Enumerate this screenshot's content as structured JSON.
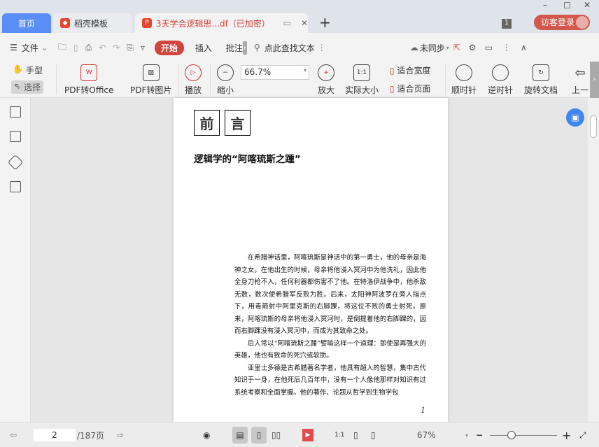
{
  "tabs": [
    {
      "label": "首页"
    },
    {
      "label": "稻壳模板"
    },
    {
      "label": "3天学会逻辑思...df（已加密）"
    }
  ],
  "window": {
    "page_badge": "1",
    "login": "访客登录"
  },
  "toolbar": {
    "file": "文件",
    "start": "开始",
    "insert": "插入",
    "annotate": "批注",
    "search": "点此查找文本",
    "sync": "未同步"
  },
  "ribbon": {
    "hand": "手型",
    "select": "选择",
    "pdf_office": "PDF转Office",
    "pdf_image": "PDF转图片",
    "play": "播放",
    "zoom_out": "缩小",
    "zoom_value": "66.7%",
    "zoom_in": "放大",
    "actual": "实际大小",
    "fit_width": "适合宽度",
    "fit_page": "适合页面",
    "cw": "顺时针",
    "ccw": "逆时针",
    "rotate": "旋转文档",
    "prev": "上一"
  },
  "document": {
    "head1": "前",
    "head2": "言",
    "subtitle": "逻辑学的“阿喀琉斯之踵”",
    "paragraphs": [
      "在希腊神话里，阿喀琉斯是神话中的第一勇士，他的母亲是海神之女，在他出生的时候，母亲将他浸入冥河中为他洗礼，因此他全身刀枪不入，任何利器都伤害不了他。在特洛伊战争中，他杀敌无数，数次使希腊军反败为胜。后来，太阳神阿波罗在旁人指点下，用毒箭射中阿里克斯的右脚踝，将这位不败的勇士射死。原来，阿喀琉斯的母亲将他浸入冥河时，是倒提着他的右脚踝的，因而右脚踝没有浸入冥河中，而成为其致命之处。",
      "后人常以“阿喀琉斯之踵”譬喻这样一个道理：即使是再强大的英雄，他也有致命的死穴或软肋。",
      "亚里士多德是古希腊著名学者，他具有超人的智慧，集中古代知识于一身，在他死后几百年中，没有一个人像他那样对知识有过系统考察和全面掌握。他的著作、论题从哲学到生物学包"
    ],
    "page_number": "1"
  },
  "status": {
    "current_page": "2",
    "total": "/187页",
    "zoom": "67%"
  }
}
